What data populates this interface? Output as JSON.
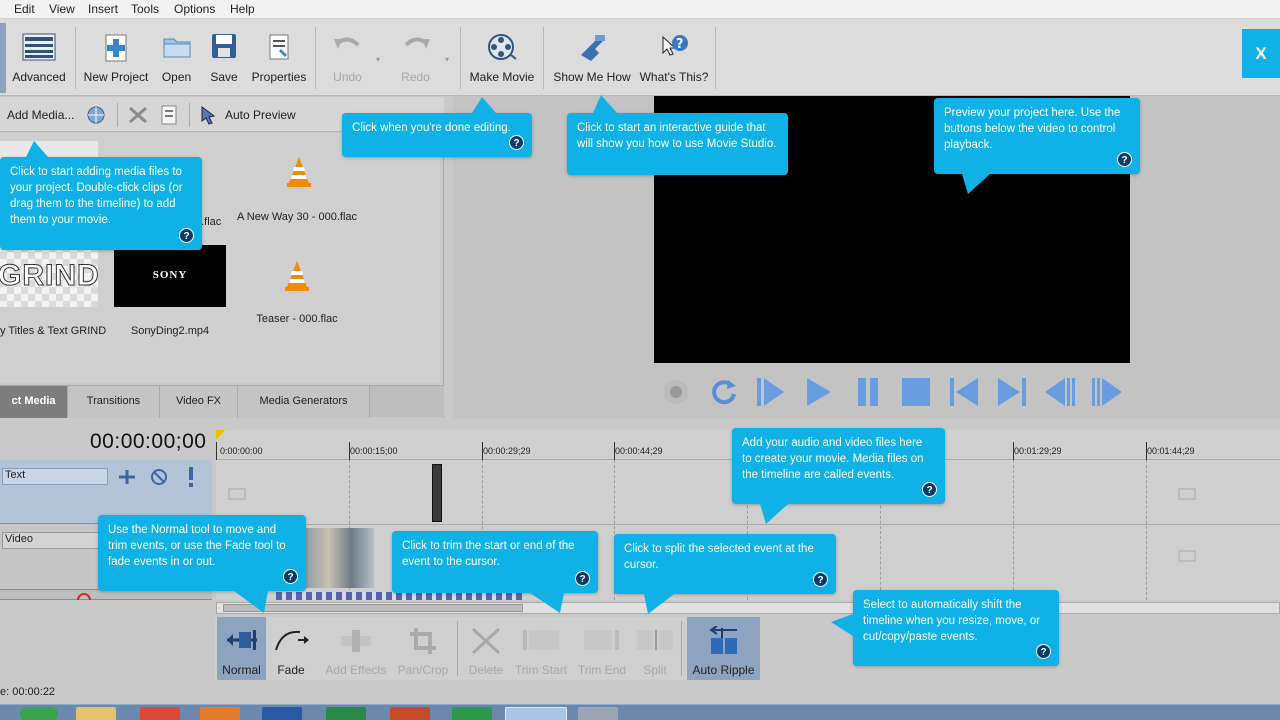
{
  "menu": [
    "Edit",
    "View",
    "Insert",
    "Tools",
    "Options",
    "Help"
  ],
  "toolbar": {
    "advanced": "Advanced",
    "new_project": "New Project",
    "open": "Open",
    "save": "Save",
    "properties": "Properties",
    "undo": "Undo",
    "redo": "Redo",
    "make_movie": "Make Movie",
    "show_me_how": "Show Me How",
    "whats_this": "What's This?",
    "close": "X"
  },
  "media_panel": {
    "add_media": "Add Media...",
    "auto_preview": "Auto Preview",
    "items": [
      {
        "label": "0.flac"
      },
      {
        "label": "A New Way 30 - 000.flac"
      },
      {
        "label": "y Titles & Text GRIND",
        "thumb_text": "GRIND"
      },
      {
        "label": "SonyDing2.mp4",
        "thumb_text": "SONY"
      },
      {
        "label": "Teaser - 000.flac"
      }
    ],
    "tabs": [
      "ct Media",
      "Transitions",
      "Video FX",
      "Media Generators"
    ]
  },
  "timeline": {
    "timecode": "00:00:00;00",
    "ruler": [
      "0:00:00:00",
      "00:00:15;00",
      "00:00:29;29",
      "00:00:44;29",
      "00:01:29;29",
      "00:01:44;29"
    ],
    "tracks": [
      "Text",
      "Video"
    ]
  },
  "bottom_tools": {
    "normal": "Normal",
    "fade": "Fade",
    "add_effects": "Add Effects",
    "pan_crop": "Pan/Crop",
    "delete": "Delete",
    "trim_start": "Trim Start",
    "trim_end": "Trim End",
    "split": "Split",
    "auto_ripple": "Auto Ripple"
  },
  "status": "e: 00:00:22",
  "callouts": {
    "add_media": "Click to start adding media files to your project. Double-click clips (or drag them to the timeline) to add them to your movie.",
    "make_movie": "Click when you're done editing.",
    "show_me_how": "Click to start an interactive guide that will show you how to use Movie Studio.",
    "preview": "Preview your project here. Use the buttons below the video to control playback.",
    "timeline": "Add your audio and video files here to create your movie. Media files on the timeline are called events.",
    "normal_tool": "Use the Normal tool to move and trim events, or use the Fade tool to fade events in or out.",
    "trim": "Click to trim the start or end of the event to the cursor.",
    "split": "Click to split the selected event at the cursor.",
    "auto_ripple": "Select to automatically shift the timeline when you resize, move, or cut/copy/paste events.",
    "help_glyph": "?"
  },
  "colors": {
    "callout": "#0fb1e6",
    "accent": "#0fb1e6"
  }
}
